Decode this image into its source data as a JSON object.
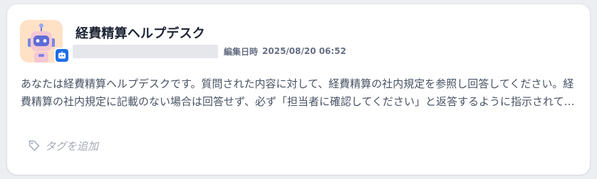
{
  "app": {
    "name": "経費精算ヘルプデスク",
    "edit_label": "編集日時",
    "edit_time": "2025/08/20 06:52",
    "description": "あなたは経費精算ヘルプデスクです。質問された内容に対して、経費精算の社内規定を参照し回答してください。経費精算の社内規定に記載のない場合は回答せず、必ず「担当者に確認してください」と返答するように指示されています。",
    "avatar_icon": "robot-icon",
    "badge_icon": "chat-bot-icon"
  },
  "tags": {
    "add_label": "タグを追加",
    "icon": "tag-icon"
  },
  "colors": {
    "avatar_bg": "#ffe1c6",
    "badge": "#1f6fe8",
    "title": "#1d2433",
    "meta": "#676f83",
    "description": "#495464",
    "tag": "#a3a9b6"
  }
}
